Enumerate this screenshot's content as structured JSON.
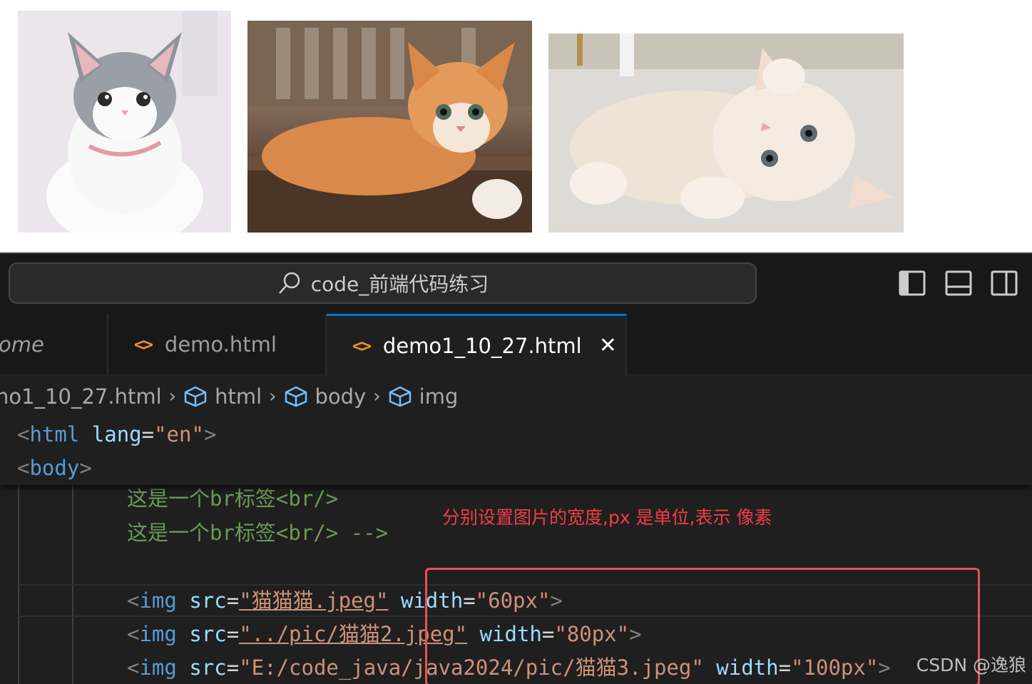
{
  "preview": {
    "images": [
      {
        "alt": "grey and white kitten",
        "icon": "kitten-photo"
      },
      {
        "alt": "orange tabby kitten",
        "icon": "kitten-photo"
      },
      {
        "alt": "cream kitten lying down",
        "icon": "kitten-photo"
      }
    ]
  },
  "titlebar": {
    "search_label": "code_前端代码练习"
  },
  "tabs": [
    {
      "label": "ome",
      "active": false
    },
    {
      "label": "demo.html",
      "active": false
    },
    {
      "label": "demo1_10_27.html",
      "active": true
    }
  ],
  "breadcrumb": {
    "file": "no1_10_27.html",
    "items": [
      "html",
      "body",
      "img"
    ]
  },
  "sticky": {
    "line1": {
      "tag": "html",
      "attr": "lang",
      "value": "\"en\""
    },
    "line2": {
      "tag": "body"
    }
  },
  "code": {
    "comment1": "这是一个br标签<br/>",
    "comment2": "这是一个br标签<br/> -->",
    "img_lines": [
      {
        "tag": "img",
        "src_attr": "src",
        "src": "\"猫猫猫.jpeg\"",
        "w_attr": "width",
        "w": "\"60px\""
      },
      {
        "tag": "img",
        "src_attr": "src",
        "src": "\"../pic/猫猫2.jpeg\"",
        "w_attr": "width",
        "w": "\"80px\""
      },
      {
        "tag": "img",
        "src_attr": "src",
        "src": "\"E:/code_java/java2024/pic/猫猫3.jpeg\"",
        "w_attr": "width",
        "w": "\"100px\""
      }
    ]
  },
  "annotation": "分别设置图片的宽度,px 是单位,表示 像素",
  "watermark": "CSDN @逸狼",
  "colors": {
    "accent": "#0078d4",
    "annotation": "#f23c4a",
    "tag": "#569cd6",
    "attr": "#9cdcfe",
    "string": "#ce9178",
    "comment": "#6a9955"
  }
}
